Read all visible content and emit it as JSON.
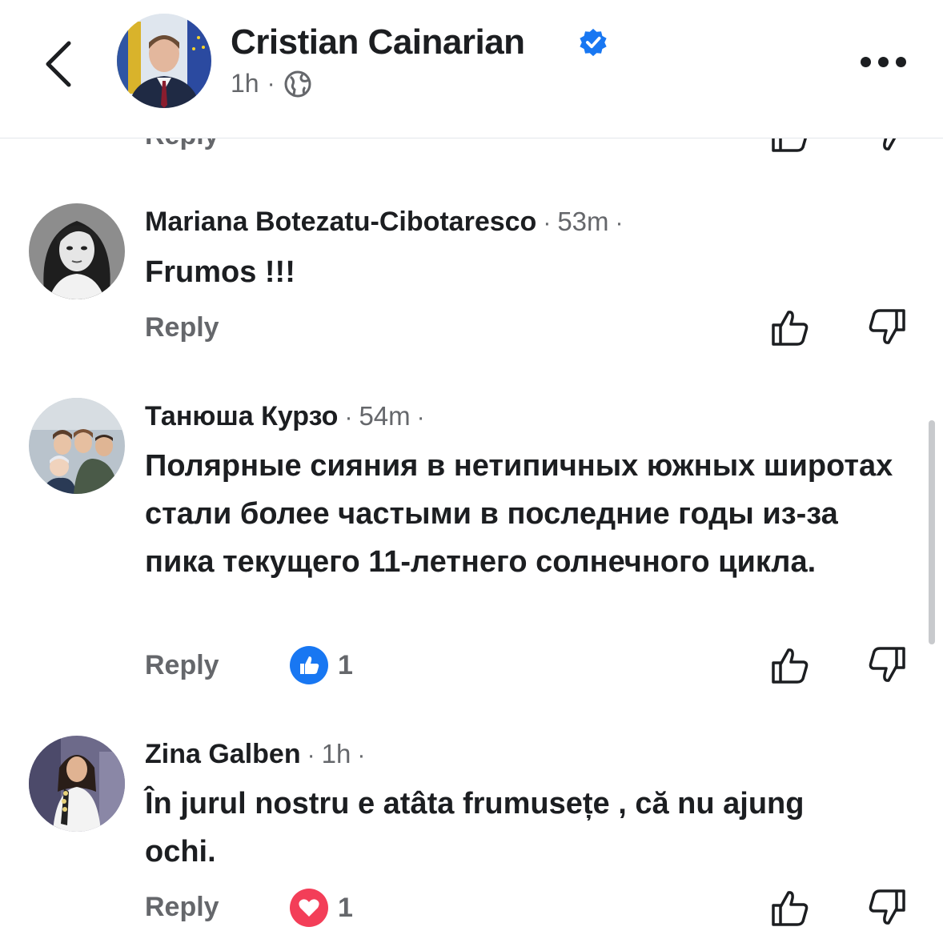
{
  "header": {
    "title": "Cristian Cainarian",
    "time": "1h",
    "separator": "·"
  },
  "partial_above": {
    "reply_label": "Reply"
  },
  "comments": [
    {
      "author": "Mariana Botezatu-Cibotaresco",
      "time": "53m",
      "text": "Frumos !!!",
      "reply_label": "Reply",
      "reaction": null
    },
    {
      "author": "Танюша Курзо",
      "time": "54m",
      "text": "Полярные сияния в нетипичных южных широтах стали более частыми в последние годы из-за пика текущего 11-летнего солнечного цикла.",
      "reply_label": "Reply",
      "reaction": {
        "type": "like",
        "count": "1",
        "color": "#1877f2"
      }
    },
    {
      "author": "Zina Galben",
      "time": "1h",
      "text": "În jurul nostru e atâta frumusețe , că nu ajung ochi.",
      "reply_label": "Reply",
      "reaction": {
        "type": "love",
        "count": "1",
        "color": "#f33e58"
      }
    }
  ],
  "colors": {
    "accent": "#1877f2",
    "muted": "#65676b",
    "text": "#1c1e21"
  },
  "icons": [
    "back-icon",
    "verified-badge-icon",
    "globe-icon",
    "more-icon",
    "like-outline-icon",
    "dislike-outline-icon",
    "like-reaction-icon",
    "love-reaction-icon"
  ]
}
